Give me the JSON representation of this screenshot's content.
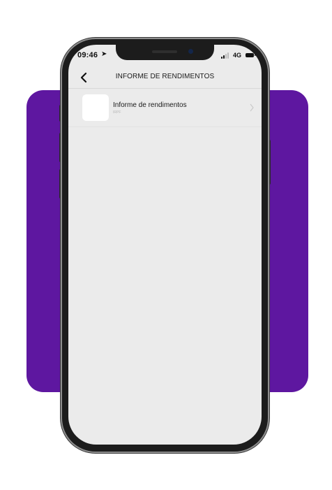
{
  "colors": {
    "backdrop": "#5e17a0",
    "screen_bg": "#ebebeb",
    "phone_frame": "#1c1c1c"
  },
  "status_bar": {
    "time": "09:46",
    "location_glyph": "➤",
    "network": "4G",
    "icons": [
      "location-arrow-icon",
      "signal-bars-icon",
      "battery-icon"
    ]
  },
  "nav": {
    "back_icon": "chevron-left-icon",
    "title": "INFORME DE RENDIMENTOS"
  },
  "list": {
    "items": [
      {
        "title": "Informe de rendimentos",
        "subtitle": "IRPF",
        "icon": "chevron-right-icon"
      }
    ]
  }
}
